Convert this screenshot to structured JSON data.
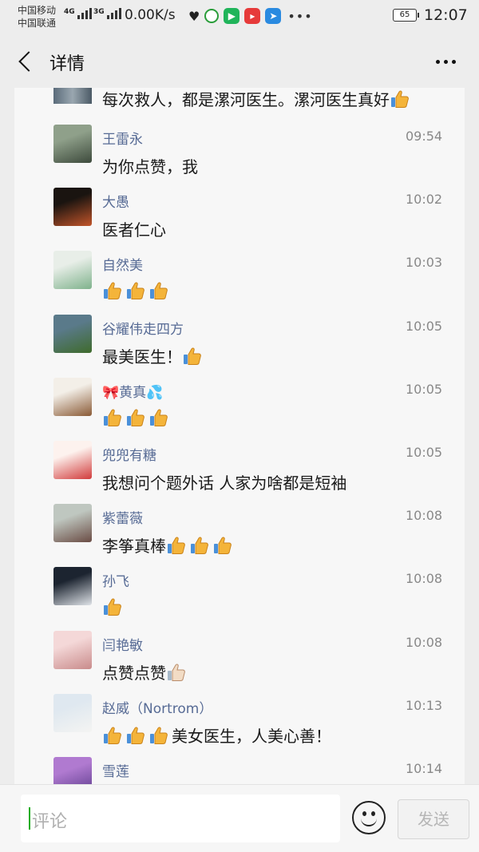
{
  "status_bar": {
    "carrier_1": "中国移动",
    "carrier_2": "中国联通",
    "net_1": "4G",
    "net_2": "3G",
    "speed": "0.00K/s",
    "battery": "65",
    "time": "12:07"
  },
  "header": {
    "title": "详情"
  },
  "top_partial_comment": {
    "text_prefix": "每次救人，都是漯河医生。漯河医生真好"
  },
  "comments": [
    {
      "name": "王雷永",
      "time": "09:54",
      "text": "为你点赞，我",
      "thumbs_before": 0,
      "thumbs_after": 0,
      "avatar_colors": [
        "#8fa08a",
        "#3d4a3c"
      ]
    },
    {
      "name": "大愚",
      "time": "10:02",
      "text": "医者仁心",
      "thumbs_before": 0,
      "thumbs_after": 0,
      "avatar_colors": [
        "#1a1410",
        "#c2552a"
      ]
    },
    {
      "name": "自然美",
      "time": "10:03",
      "text": "",
      "thumbs_before": 3,
      "thumbs_after": 0,
      "avatar_colors": [
        "#e8eee8",
        "#7fb28c"
      ]
    },
    {
      "name": "谷耀伟走四方",
      "time": "10:05",
      "text": "最美医生！",
      "thumbs_before": 0,
      "thumbs_after": 1,
      "avatar_colors": [
        "#5a7a8a",
        "#3f6b2c"
      ]
    },
    {
      "name": "黄真",
      "name_prefix_icon": "ribbon-bow",
      "name_suffix_icon": "sweat-droplets",
      "time": "10:05",
      "text": "",
      "thumbs_before": 3,
      "thumbs_after": 0,
      "avatar_colors": [
        "#f3efe8",
        "#8a5a35"
      ]
    },
    {
      "name": "兜兜有糖",
      "time": "10:05",
      "text": "我想问个题外话 人家为啥都是短袖",
      "thumbs_before": 0,
      "thumbs_after": 0,
      "avatar_colors": [
        "#fdf2ee",
        "#d13b3b"
      ]
    },
    {
      "name": "紫蕾薇",
      "time": "10:08",
      "text": "李筝真棒",
      "thumbs_before": 0,
      "thumbs_after": 3,
      "avatar_colors": [
        "#bfc7c0",
        "#6a4c44"
      ]
    },
    {
      "name": "孙飞",
      "time": "10:08",
      "text": "",
      "thumbs_before": 1,
      "thumbs_after": 0,
      "avatar_colors": [
        "#1c2430",
        "#dfe3e8"
      ]
    },
    {
      "name": "闫艳敏",
      "time": "10:08",
      "text": "点赞点赞",
      "thumbs_before": 0,
      "thumbs_after": 1,
      "thumb_light": true,
      "avatar_colors": [
        "#f4d8d8",
        "#c98b8b"
      ]
    },
    {
      "name": "赵威（Nortrom）",
      "time": "10:13",
      "text": "美女医生，人美心善！",
      "thumbs_before": 3,
      "thumbs_after": 0,
      "avatar_colors": [
        "#dfe8f0",
        "#f4f4f2"
      ]
    },
    {
      "name": "雪莲",
      "time": "10:14",
      "text": "",
      "thumbs_before": 0,
      "thumbs_after": 0,
      "avatar_colors": [
        "#b07ad0",
        "#5a3a8a"
      ]
    }
  ],
  "input_bar": {
    "placeholder": "评论",
    "send_label": "发送"
  },
  "colors": {
    "name_link": "#576b95",
    "accent_green": "#1aad19"
  }
}
